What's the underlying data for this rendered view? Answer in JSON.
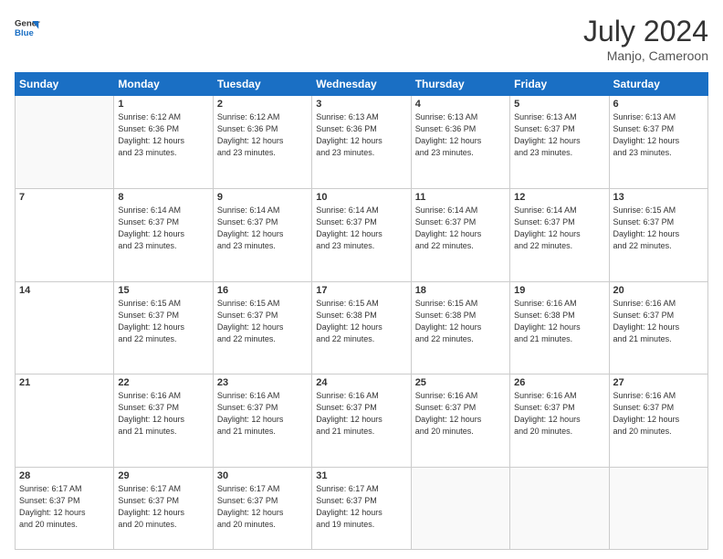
{
  "header": {
    "logo_line1": "General",
    "logo_line2": "Blue",
    "month": "July 2024",
    "location": "Manjo, Cameroon"
  },
  "days_of_week": [
    "Sunday",
    "Monday",
    "Tuesday",
    "Wednesday",
    "Thursday",
    "Friday",
    "Saturday"
  ],
  "weeks": [
    [
      {
        "day": "",
        "info": ""
      },
      {
        "day": "1",
        "info": "Sunrise: 6:12 AM\nSunset: 6:36 PM\nDaylight: 12 hours\nand 23 minutes."
      },
      {
        "day": "2",
        "info": "Sunrise: 6:12 AM\nSunset: 6:36 PM\nDaylight: 12 hours\nand 23 minutes."
      },
      {
        "day": "3",
        "info": "Sunrise: 6:13 AM\nSunset: 6:36 PM\nDaylight: 12 hours\nand 23 minutes."
      },
      {
        "day": "4",
        "info": "Sunrise: 6:13 AM\nSunset: 6:36 PM\nDaylight: 12 hours\nand 23 minutes."
      },
      {
        "day": "5",
        "info": "Sunrise: 6:13 AM\nSunset: 6:37 PM\nDaylight: 12 hours\nand 23 minutes."
      },
      {
        "day": "6",
        "info": "Sunrise: 6:13 AM\nSunset: 6:37 PM\nDaylight: 12 hours\nand 23 minutes."
      }
    ],
    [
      {
        "day": "7",
        "info": ""
      },
      {
        "day": "8",
        "info": "Sunrise: 6:14 AM\nSunset: 6:37 PM\nDaylight: 12 hours\nand 23 minutes."
      },
      {
        "day": "9",
        "info": "Sunrise: 6:14 AM\nSunset: 6:37 PM\nDaylight: 12 hours\nand 23 minutes."
      },
      {
        "day": "10",
        "info": "Sunrise: 6:14 AM\nSunset: 6:37 PM\nDaylight: 12 hours\nand 23 minutes."
      },
      {
        "day": "11",
        "info": "Sunrise: 6:14 AM\nSunset: 6:37 PM\nDaylight: 12 hours\nand 22 minutes."
      },
      {
        "day": "12",
        "info": "Sunrise: 6:14 AM\nSunset: 6:37 PM\nDaylight: 12 hours\nand 22 minutes."
      },
      {
        "day": "13",
        "info": "Sunrise: 6:15 AM\nSunset: 6:37 PM\nDaylight: 12 hours\nand 22 minutes."
      }
    ],
    [
      {
        "day": "14",
        "info": ""
      },
      {
        "day": "15",
        "info": "Sunrise: 6:15 AM\nSunset: 6:37 PM\nDaylight: 12 hours\nand 22 minutes."
      },
      {
        "day": "16",
        "info": "Sunrise: 6:15 AM\nSunset: 6:37 PM\nDaylight: 12 hours\nand 22 minutes."
      },
      {
        "day": "17",
        "info": "Sunrise: 6:15 AM\nSunset: 6:38 PM\nDaylight: 12 hours\nand 22 minutes."
      },
      {
        "day": "18",
        "info": "Sunrise: 6:15 AM\nSunset: 6:38 PM\nDaylight: 12 hours\nand 22 minutes."
      },
      {
        "day": "19",
        "info": "Sunrise: 6:16 AM\nSunset: 6:38 PM\nDaylight: 12 hours\nand 21 minutes."
      },
      {
        "day": "20",
        "info": "Sunrise: 6:16 AM\nSunset: 6:37 PM\nDaylight: 12 hours\nand 21 minutes."
      }
    ],
    [
      {
        "day": "21",
        "info": ""
      },
      {
        "day": "22",
        "info": "Sunrise: 6:16 AM\nSunset: 6:37 PM\nDaylight: 12 hours\nand 21 minutes."
      },
      {
        "day": "23",
        "info": "Sunrise: 6:16 AM\nSunset: 6:37 PM\nDaylight: 12 hours\nand 21 minutes."
      },
      {
        "day": "24",
        "info": "Sunrise: 6:16 AM\nSunset: 6:37 PM\nDaylight: 12 hours\nand 21 minutes."
      },
      {
        "day": "25",
        "info": "Sunrise: 6:16 AM\nSunset: 6:37 PM\nDaylight: 12 hours\nand 20 minutes."
      },
      {
        "day": "26",
        "info": "Sunrise: 6:16 AM\nSunset: 6:37 PM\nDaylight: 12 hours\nand 20 minutes."
      },
      {
        "day": "27",
        "info": "Sunrise: 6:16 AM\nSunset: 6:37 PM\nDaylight: 12 hours\nand 20 minutes."
      }
    ],
    [
      {
        "day": "28",
        "info": "Sunrise: 6:17 AM\nSunset: 6:37 PM\nDaylight: 12 hours\nand 20 minutes."
      },
      {
        "day": "29",
        "info": "Sunrise: 6:17 AM\nSunset: 6:37 PM\nDaylight: 12 hours\nand 20 minutes."
      },
      {
        "day": "30",
        "info": "Sunrise: 6:17 AM\nSunset: 6:37 PM\nDaylight: 12 hours\nand 20 minutes."
      },
      {
        "day": "31",
        "info": "Sunrise: 6:17 AM\nSunset: 6:37 PM\nDaylight: 12 hours\nand 19 minutes."
      },
      {
        "day": "",
        "info": ""
      },
      {
        "day": "",
        "info": ""
      },
      {
        "day": "",
        "info": ""
      }
    ]
  ]
}
